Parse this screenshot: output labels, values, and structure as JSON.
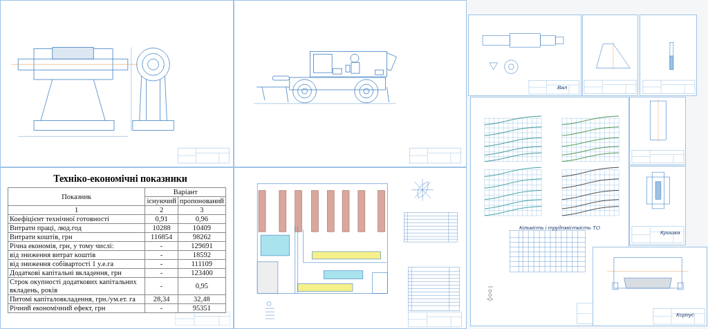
{
  "economics_sheet": {
    "title": "Техніко-економічні показники",
    "header": {
      "indicator": "Показник",
      "variant": "Варіант",
      "existing": "існуючий",
      "proposed": "пропонований"
    },
    "column_numbers": [
      "1",
      "2",
      "3"
    ],
    "rows": [
      {
        "indicator": "Коефіцієнт технічної готовності",
        "existing": "0,91",
        "proposed": "0,96"
      },
      {
        "indicator": "Витрати праці, люд.год",
        "existing": "10288",
        "proposed": "10409"
      },
      {
        "indicator": "Витрати коштів, грн",
        "existing": "116854",
        "proposed": "98262"
      },
      {
        "indicator": "Річна економія, грн, у тому числі:",
        "existing": "-",
        "proposed": "129691"
      },
      {
        "indicator": "від зниження витрат коштів",
        "existing": "-",
        "proposed": "18592"
      },
      {
        "indicator": "від зниження собівартості 1 у.е.га",
        "existing": "-",
        "proposed": "111109"
      },
      {
        "indicator": "Додаткові капітальні вкладення, грн",
        "existing": "-",
        "proposed": "123400"
      },
      {
        "indicator": "Строк окупності додаткових капітальних вкладень, років",
        "existing": "-",
        "proposed": "0,95"
      },
      {
        "indicator": "Питомі капіталовкладення, грн./ум.ет. га",
        "existing": "28,34",
        "proposed": "32,48"
      },
      {
        "indicator": "Річний економічний ефект, грн",
        "existing": "-",
        "proposed": "95351"
      }
    ]
  },
  "part_sheets": [
    {
      "label": "Вал"
    },
    {
      "label": "Кришка"
    },
    {
      "label": "Корпус"
    }
  ],
  "charts_sheet": {
    "table_title": "Кількість і трудомісткість ТО"
  }
}
